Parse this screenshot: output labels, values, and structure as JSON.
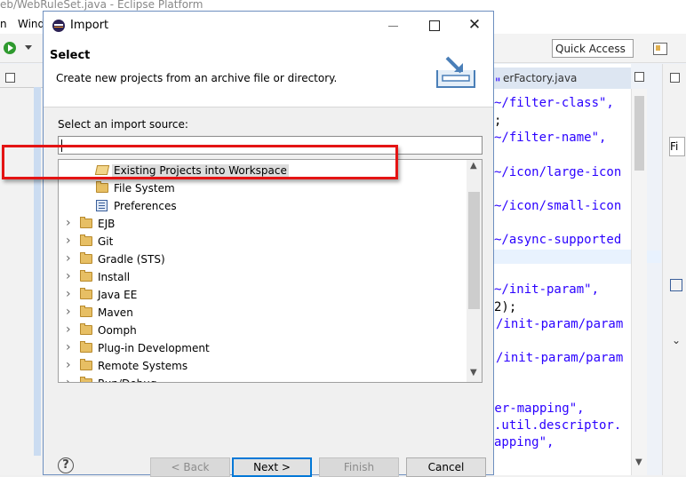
{
  "background": {
    "window_title": "eb/WebRuleSet.java - Eclipse Platform",
    "menu_items": [
      "n",
      "Wind"
    ],
    "quick_access": "Quick Access",
    "editor_tab": "erFactory.java",
    "code_lines": [
      {
        "text": "\"",
        "color": "blue"
      },
      {
        "text": "~/filter-class\",",
        "color": "blue"
      },
      {
        "text": ";",
        "color": "black"
      },
      {
        "text": "~/filter-name\",",
        "color": "blue"
      },
      {
        "text": "~/icon/large-icon",
        "color": "blue"
      },
      {
        "text": "~/icon/small-icon",
        "color": "blue"
      },
      {
        "text": "~/async-supported",
        "color": "blue"
      },
      {
        "text": "~/init-param\",",
        "color": "blue"
      },
      {
        "text": "2);",
        "color": "black"
      },
      {
        "text": "/init-param/param",
        "color": "blue"
      },
      {
        "text": "/init-param/param",
        "color": "blue"
      },
      {
        "text": "ter-mapping\",",
        "color": "blue"
      },
      {
        "text": ".util.descriptor.",
        "color": "blue"
      },
      {
        "text": "apping\",",
        "color": "blue"
      }
    ],
    "right_panel_filter": "Fi"
  },
  "dialog": {
    "title": "Import",
    "heading": "Select",
    "description": "Create new projects from an archive file or directory.",
    "source_label": "Select an import source:",
    "filter_value": "",
    "tree": [
      {
        "label": "Existing Projects into Workspace",
        "icon": "open-folder-icon",
        "level": 1,
        "expandable": false,
        "selected": true
      },
      {
        "label": "File System",
        "icon": "folder-icon",
        "level": 1,
        "expandable": false,
        "selected": false
      },
      {
        "label": "Preferences",
        "icon": "preferences-icon",
        "level": 1,
        "expandable": false,
        "selected": false
      },
      {
        "label": "EJB",
        "icon": "folder-icon",
        "level": 0,
        "expandable": true,
        "selected": false
      },
      {
        "label": "Git",
        "icon": "folder-icon",
        "level": 0,
        "expandable": true,
        "selected": false
      },
      {
        "label": "Gradle (STS)",
        "icon": "folder-icon",
        "level": 0,
        "expandable": true,
        "selected": false
      },
      {
        "label": "Install",
        "icon": "folder-icon",
        "level": 0,
        "expandable": true,
        "selected": false
      },
      {
        "label": "Java EE",
        "icon": "folder-icon",
        "level": 0,
        "expandable": true,
        "selected": false
      },
      {
        "label": "Maven",
        "icon": "folder-icon",
        "level": 0,
        "expandable": true,
        "selected": false
      },
      {
        "label": "Oomph",
        "icon": "folder-icon",
        "level": 0,
        "expandable": true,
        "selected": false
      },
      {
        "label": "Plug-in Development",
        "icon": "folder-icon",
        "level": 0,
        "expandable": true,
        "selected": false
      },
      {
        "label": "Remote Systems",
        "icon": "folder-icon",
        "level": 0,
        "expandable": true,
        "selected": false
      },
      {
        "label": "Run/Debug",
        "icon": "folder-icon",
        "level": 0,
        "expandable": true,
        "selected": false
      }
    ],
    "buttons": {
      "back": "< Back",
      "next": "Next >",
      "finish": "Finish",
      "cancel": "Cancel"
    },
    "help_glyph": "?"
  },
  "colors": {
    "highlight_box": "#e41414",
    "code_string": "#2a00ff",
    "default_button_border": "#0078d7"
  }
}
